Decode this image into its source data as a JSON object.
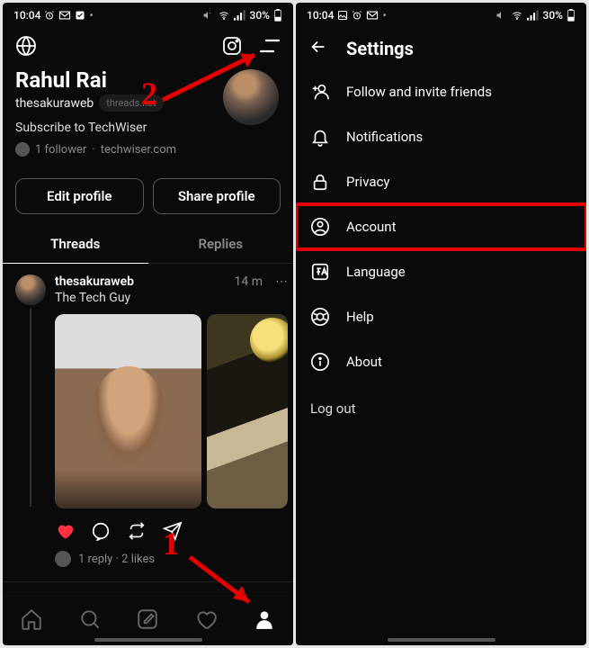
{
  "left": {
    "statusbar": {
      "time": "10:04",
      "battery": "30%"
    },
    "profile": {
      "name": "Rahul Rai",
      "handle": "thesakuraweb",
      "domain_chip": "threads.net",
      "bio": "Subscribe to TechWiser",
      "followers_text": "1 follower",
      "link_text": "techwiser.com"
    },
    "buttons": {
      "edit": "Edit profile",
      "share": "Share profile"
    },
    "tabs": {
      "threads": "Threads",
      "replies": "Replies"
    },
    "post": {
      "user": "thesakuraweb",
      "time": "14 m",
      "text": "The Tech Guy",
      "meta": "1 reply · 2 likes"
    },
    "annotations": {
      "one": "1",
      "two": "2"
    }
  },
  "right": {
    "statusbar": {
      "time": "10:04",
      "battery": "30%"
    },
    "title": "Settings",
    "items": {
      "follow": "Follow and invite friends",
      "notifications": "Notifications",
      "privacy": "Privacy",
      "account": "Account",
      "language": "Language",
      "help": "Help",
      "about": "About"
    },
    "logout": "Log out"
  }
}
